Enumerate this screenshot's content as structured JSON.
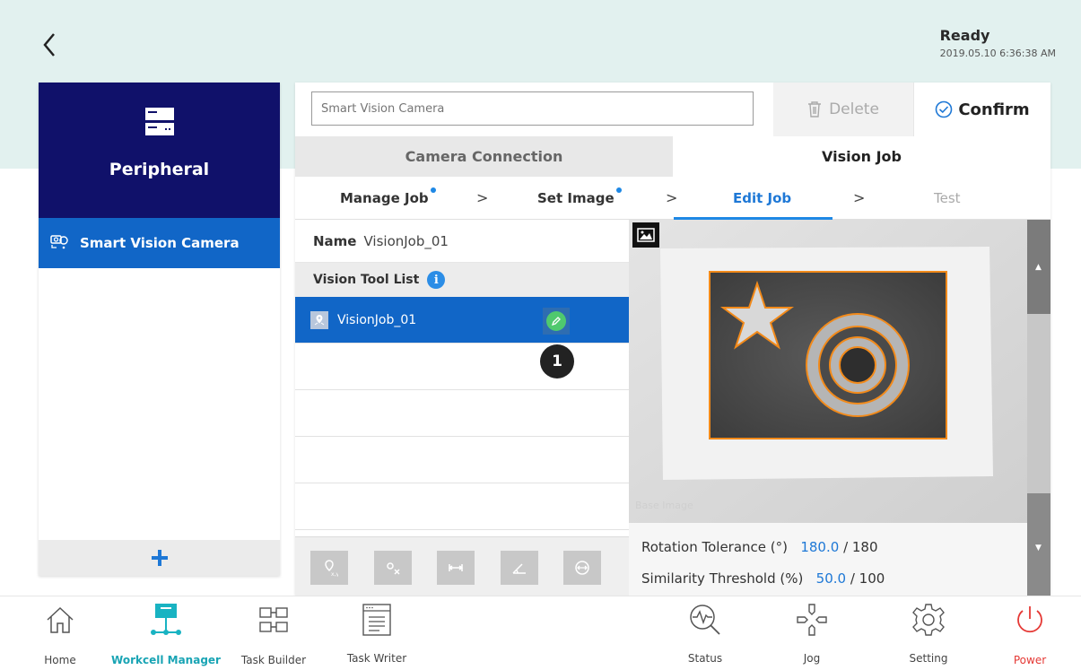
{
  "status": {
    "title": "Ready",
    "timestamp": "2019.05.10 6:36:38 AM"
  },
  "left_panel": {
    "title": "Peripheral",
    "items": [
      {
        "label": "Smart Vision Camera"
      }
    ],
    "add_label": "+"
  },
  "header": {
    "name_placeholder": "Smart Vision Camera",
    "delete_label": "Delete",
    "confirm_label": "Confirm"
  },
  "tabs": [
    {
      "label": "Camera Connection"
    },
    {
      "label": "Vision Job",
      "active": true
    }
  ],
  "steps": [
    {
      "label": "Manage Job"
    },
    {
      "label": "Set Image"
    },
    {
      "label": "Edit Job",
      "active": true
    },
    {
      "label": "Test"
    }
  ],
  "job": {
    "name_label": "Name",
    "name_value": "VisionJob_01",
    "tool_list_label": "Vision Tool List",
    "info_glyph": "i",
    "tools": [
      {
        "label": "VisionJob_01",
        "selected": true
      }
    ],
    "callout": "1"
  },
  "image": {
    "base_label": "Base Image"
  },
  "params": {
    "rotation_label": "Rotation Tolerance (°)",
    "rotation_value": "180.0",
    "rotation_max": "/ 180",
    "similarity_label": "Similarity Threshold (%)",
    "similarity_value": "50.0",
    "similarity_max": "/ 100"
  },
  "nav": {
    "home": "Home",
    "workcell": "Workcell Manager",
    "task_builder": "Task Builder",
    "task_writer": "Task Writer",
    "status": "Status",
    "jog": "Jog",
    "setting": "Setting",
    "power": "Power"
  },
  "colors": {
    "accent": "#1166c7",
    "header_navy": "#10116a",
    "teal": "#19b3c2",
    "power_red": "#e53935",
    "top_band": "#e2f1ef",
    "orange_outline": "#f28a1a"
  },
  "icons": [
    "back-icon",
    "server-icon",
    "camera-location-icon",
    "plus-icon",
    "trash-icon",
    "check-circle-icon",
    "info-icon",
    "vision-tool-icon",
    "edit-icon",
    "image-toggle-icon",
    "home-icon",
    "workcell-icon",
    "task-builder-icon",
    "task-writer-icon",
    "status-icon",
    "jog-icon",
    "setting-icon",
    "power-icon"
  ]
}
